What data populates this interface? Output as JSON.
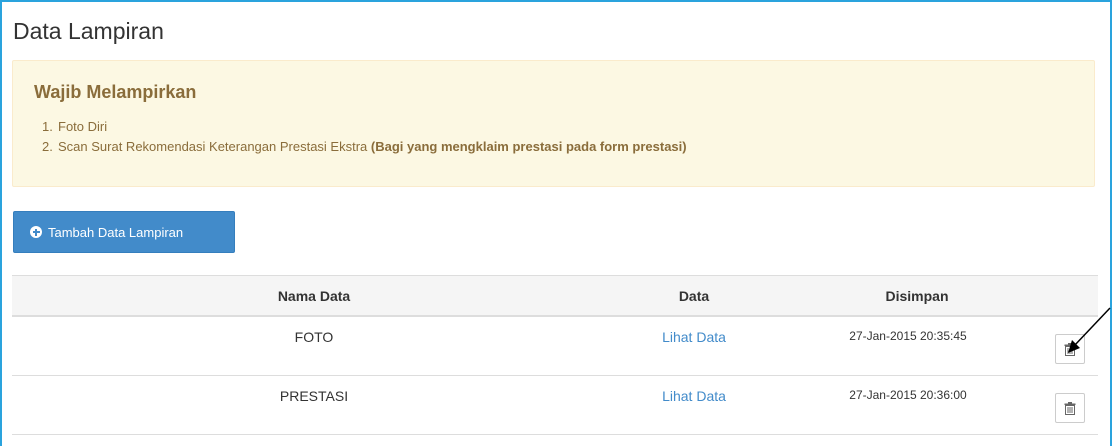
{
  "page": {
    "title": "Data Lampiran"
  },
  "alert": {
    "title": "Wajib Melampirkan",
    "items": [
      {
        "num": "1.",
        "text": "Foto Diri",
        "bold": ""
      },
      {
        "num": "2.",
        "text": "Scan Surat Rekomendasi Keterangan Prestasi Ekstra ",
        "bold": "(Bagi yang mengklaim prestasi pada form prestasi)"
      }
    ]
  },
  "toolbar": {
    "add_label": "Tambah Data Lampiran"
  },
  "table": {
    "headers": {
      "nama": "Nama Data",
      "data": "Data",
      "disimpan": "Disimpan"
    },
    "rows": [
      {
        "nama": "FOTO",
        "link": "Lihat Data",
        "disimpan": "27-Jan-2015 20:35:45"
      },
      {
        "nama": "PRESTASI",
        "link": "Lihat Data",
        "disimpan": "27-Jan-2015 20:36:00"
      }
    ]
  },
  "colors": {
    "frame": "#2aa3dd",
    "alert_bg": "#fcf8e3",
    "alert_text": "#8a6d3b",
    "primary": "#428bca",
    "link": "#428bca"
  },
  "icons": {
    "add": "plus-circle-icon",
    "delete": "trash-icon",
    "annotation": "arrow-icon"
  }
}
